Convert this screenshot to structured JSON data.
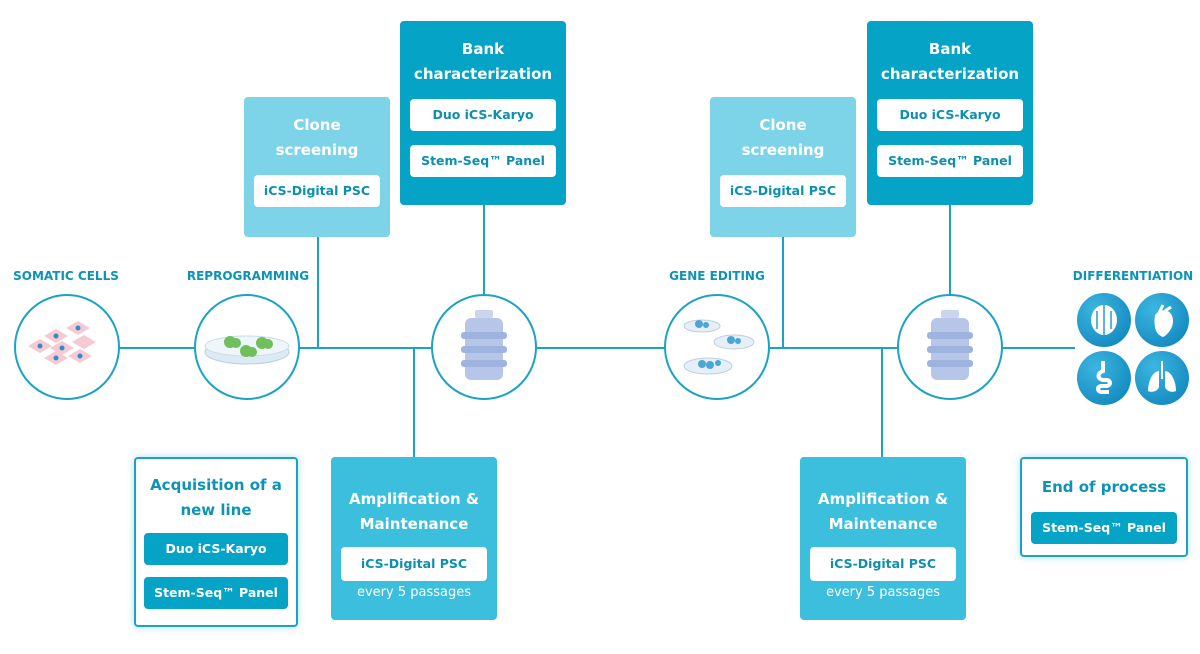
{
  "stages": {
    "somatic": "SOMATIC CELLS",
    "reprogramming": "REPROGRAMMING",
    "gene_editing": "GENE EDITING",
    "differentiation": "DIFFERENTIATION"
  },
  "clone1": {
    "title": "Clone screening",
    "item": "iCS-Digital PSC"
  },
  "bank1": {
    "title": "Bank characterization",
    "items": [
      "Duo iCS-Karyo",
      "Stem-Seq™ Panel"
    ]
  },
  "acq": {
    "title": "Acquisition of a new line",
    "items": [
      "Duo iCS-Karyo",
      "Stem-Seq™ Panel"
    ]
  },
  "amp1": {
    "title": "Amplification & Maintenance",
    "item": "iCS-Digital PSC",
    "note": "every 5 passages"
  },
  "clone2": {
    "title": "Clone screening",
    "item": "iCS-Digital PSC"
  },
  "bank2": {
    "title": "Bank characterization",
    "items": [
      "Duo iCS-Karyo",
      "Stem-Seq™ Panel"
    ]
  },
  "amp2": {
    "title": "Amplification & Maintenance",
    "item": "iCS-Digital PSC",
    "note": "every 5 passages"
  },
  "end": {
    "title": "End of process",
    "item": "Stem-Seq™ Panel"
  },
  "colors": {
    "dark": "#05a3c6",
    "light": "#7dd4e8",
    "medium": "#3bbfdc",
    "line": "#1aa3c4"
  },
  "icons": [
    "somatic-cells",
    "petri-dish-colonies",
    "cell-bank-bottle",
    "gene-edited-dishes",
    "brain",
    "heart",
    "intestine",
    "lungs"
  ]
}
